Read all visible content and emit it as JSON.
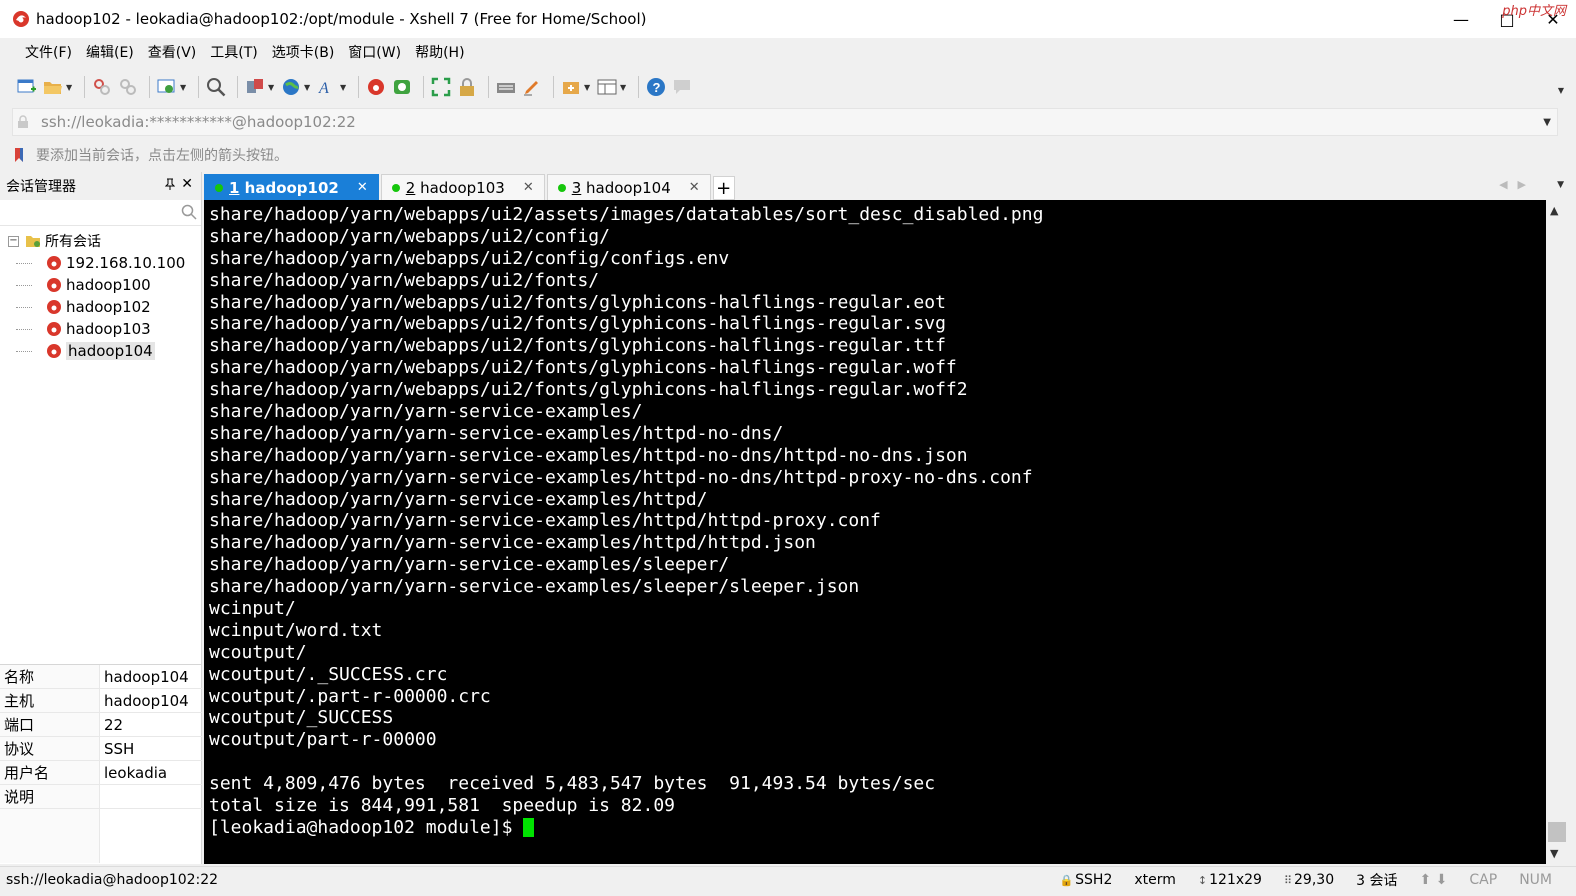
{
  "window": {
    "title": "hadoop102 - leokadia@hadoop102:/opt/module - Xshell 7 (Free for Home/School)",
    "watermark": "php中文网",
    "minimize": "—",
    "maximize": "□",
    "close": "✕"
  },
  "menu": [
    "文件(F)",
    "编辑(E)",
    "查看(V)",
    "工具(T)",
    "选项卡(B)",
    "窗口(W)",
    "帮助(H)"
  ],
  "address": {
    "value": "ssh://leokadia:***********@hadoop102:22"
  },
  "hint": "要添加当前会话，点击左侧的箭头按钮。",
  "session_panel": {
    "title": "会话管理器",
    "pin": "📌",
    "close": "✕",
    "root": "所有会话",
    "sessions": [
      "192.168.10.100",
      "hadoop100",
      "hadoop102",
      "hadoop103",
      "hadoop104"
    ],
    "selected": "hadoop104",
    "properties": [
      {
        "key": "名称",
        "value": "hadoop104"
      },
      {
        "key": "主机",
        "value": "hadoop104"
      },
      {
        "key": "端口",
        "value": "22"
      },
      {
        "key": "协议",
        "value": "SSH"
      },
      {
        "key": "用户名",
        "value": "leokadia"
      },
      {
        "key": "说明",
        "value": ""
      }
    ]
  },
  "tabs": [
    {
      "num": "1",
      "label": " hadoop102",
      "active": true
    },
    {
      "num": "2",
      "label": " hadoop103",
      "active": false
    },
    {
      "num": "3",
      "label": " hadoop104",
      "active": false
    }
  ],
  "tab_add": "+",
  "terminal": {
    "lines": [
      "share/hadoop/yarn/webapps/ui2/assets/images/datatables/sort_desc_disabled.png",
      "share/hadoop/yarn/webapps/ui2/config/",
      "share/hadoop/yarn/webapps/ui2/config/configs.env",
      "share/hadoop/yarn/webapps/ui2/fonts/",
      "share/hadoop/yarn/webapps/ui2/fonts/glyphicons-halflings-regular.eot",
      "share/hadoop/yarn/webapps/ui2/fonts/glyphicons-halflings-regular.svg",
      "share/hadoop/yarn/webapps/ui2/fonts/glyphicons-halflings-regular.ttf",
      "share/hadoop/yarn/webapps/ui2/fonts/glyphicons-halflings-regular.woff",
      "share/hadoop/yarn/webapps/ui2/fonts/glyphicons-halflings-regular.woff2",
      "share/hadoop/yarn/yarn-service-examples/",
      "share/hadoop/yarn/yarn-service-examples/httpd-no-dns/",
      "share/hadoop/yarn/yarn-service-examples/httpd-no-dns/httpd-no-dns.json",
      "share/hadoop/yarn/yarn-service-examples/httpd-no-dns/httpd-proxy-no-dns.conf",
      "share/hadoop/yarn/yarn-service-examples/httpd/",
      "share/hadoop/yarn/yarn-service-examples/httpd/httpd-proxy.conf",
      "share/hadoop/yarn/yarn-service-examples/httpd/httpd.json",
      "share/hadoop/yarn/yarn-service-examples/sleeper/",
      "share/hadoop/yarn/yarn-service-examples/sleeper/sleeper.json",
      "wcinput/",
      "wcinput/word.txt",
      "wcoutput/",
      "wcoutput/._SUCCESS.crc",
      "wcoutput/.part-r-00000.crc",
      "wcoutput/_SUCCESS",
      "wcoutput/part-r-00000",
      "",
      "sent 4,809,476 bytes  received 5,483,547 bytes  91,493.54 bytes/sec",
      "total size is 844,991,581  speedup is 82.09"
    ],
    "prompt": "[leokadia@hadoop102 module]$ ",
    "cursor_color": "#00e300"
  },
  "status": {
    "connection": "ssh://leokadia@hadoop102:22",
    "protocol": "SSH2",
    "term_type": "xterm",
    "size": "121x29",
    "position": "29,30",
    "sessions": "3 会话",
    "cap": "CAP",
    "num": "NUM"
  },
  "colors": {
    "accent": "#1a7fd8",
    "tab_dot": "#16c60c",
    "terminal_bg": "#000000",
    "terminal_fg": "#ffffff"
  }
}
